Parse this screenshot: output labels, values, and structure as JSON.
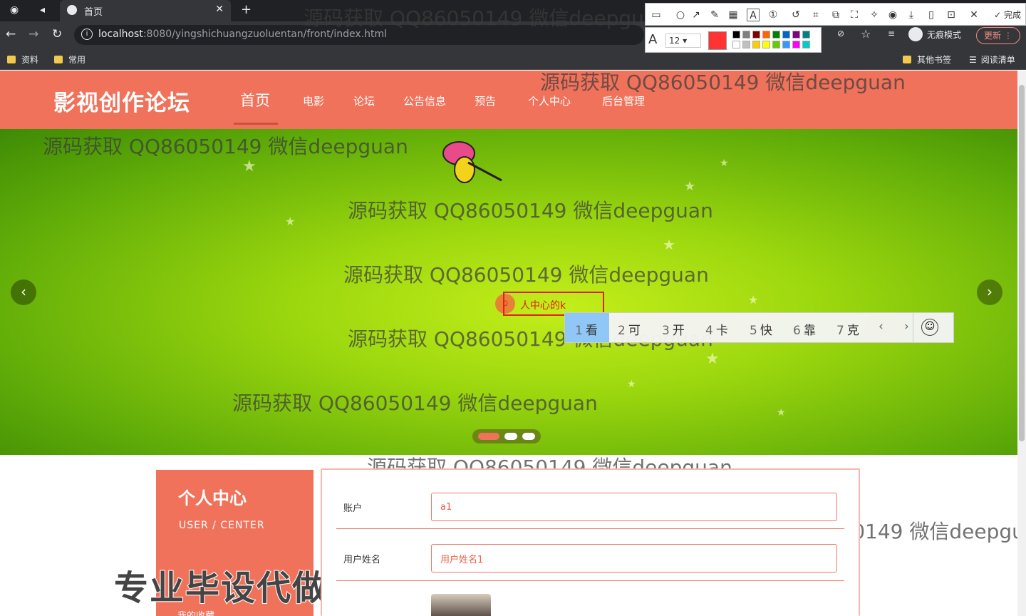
{
  "browser": {
    "tab_title": "首页",
    "url_host": "localhost",
    "url_path": ":8080/yingshichuangzuoluentan/front/index.html",
    "bookmarks": [
      "资料",
      "常用"
    ],
    "bookmarks_right": [
      "其他书签",
      "阅读清单"
    ],
    "incognito_label": "无痕模式",
    "update_label": "更新"
  },
  "screenshot_tool": {
    "done_label": "完成",
    "font_size": "12",
    "current_color": "#ff3333",
    "palette": [
      "#000000",
      "#808080",
      "#800000",
      "#ff6600",
      "#008000",
      "#0066cc",
      "#800080",
      "#008080",
      "#ffffff",
      "#c0c0c0",
      "#ffcc00",
      "#ffff00",
      "#66cc00",
      "#3399ff",
      "#ff00ff",
      "#00cccc"
    ]
  },
  "site": {
    "logo": "影视创作论坛",
    "nav": [
      "首页",
      "电影",
      "论坛",
      "公告信息",
      "预告",
      "个人中心",
      "后台管理"
    ],
    "active_nav": "首页",
    "accent_color": "#f0725a"
  },
  "ime": {
    "input_text": "人中心的k",
    "candidates": [
      {
        "n": "1",
        "w": "看"
      },
      {
        "n": "2",
        "w": "可"
      },
      {
        "n": "3",
        "w": "开"
      },
      {
        "n": "4",
        "w": "卡"
      },
      {
        "n": "5",
        "w": "快"
      },
      {
        "n": "6",
        "w": "靠"
      },
      {
        "n": "7",
        "w": "克"
      }
    ]
  },
  "sidebar": {
    "title": "个人中心",
    "subtitle": "USER / CENTER",
    "item": "我的收藏"
  },
  "promo_text": "专业毕设代做",
  "form": {
    "account_label": "账户",
    "account_value": "a1",
    "name_label": "用户姓名",
    "name_value": "用户姓名1"
  },
  "watermark": "源码获取 QQ86050149 微信deepguan"
}
